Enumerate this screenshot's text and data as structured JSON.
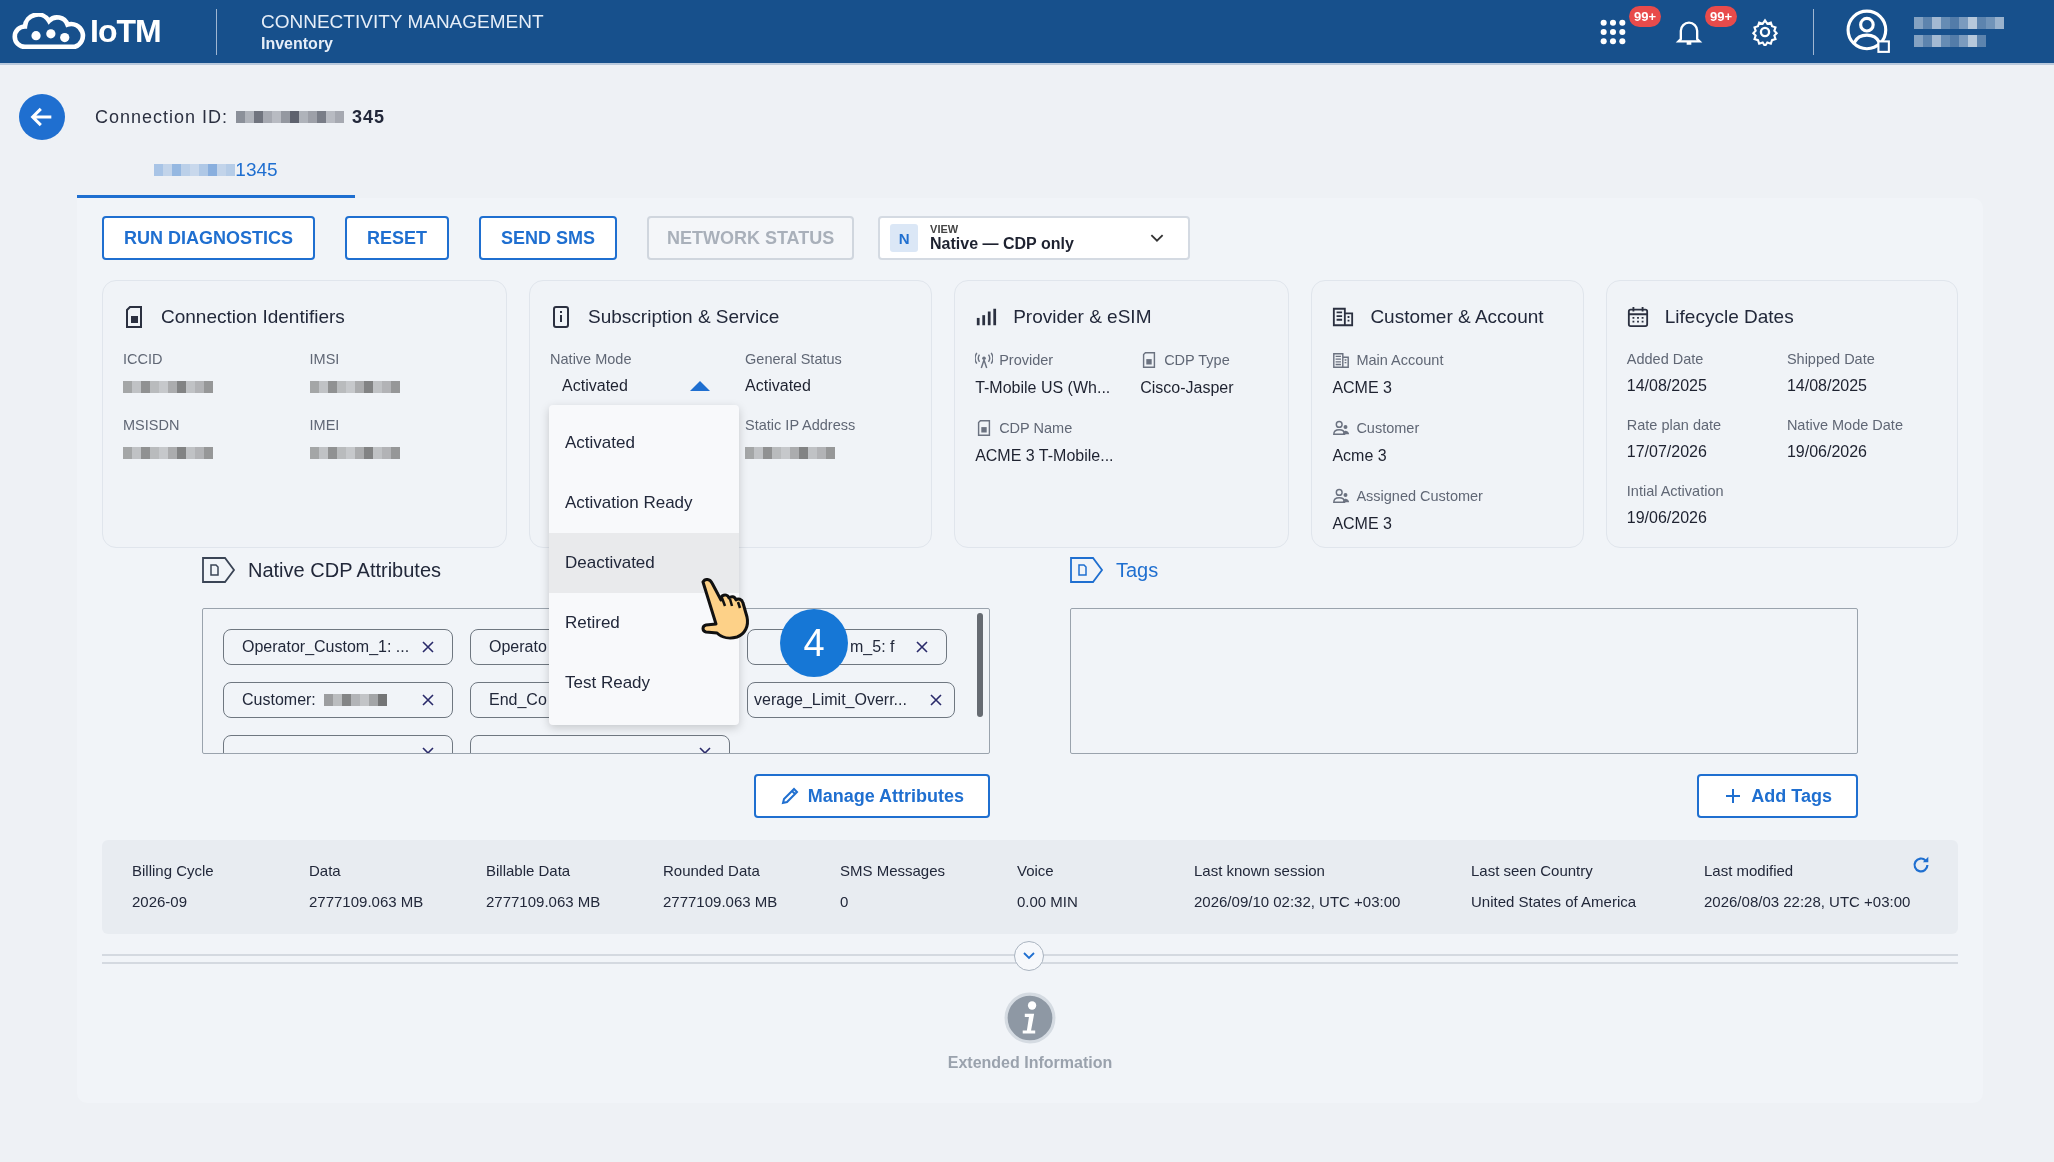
{
  "header": {
    "logo": "IoTM",
    "title": "CONNECTIVITY MANAGEMENT",
    "subtitle": "Inventory",
    "apps_badge": "99+",
    "notifications_badge": "99+"
  },
  "connection": {
    "label": "Connection ID:",
    "id_suffix": "345"
  },
  "tabs": [
    {
      "label": "1345",
      "selected": true
    }
  ],
  "actions": [
    {
      "label": "RUN DIAGNOSTICS",
      "disabled": false
    },
    {
      "label": "RESET",
      "disabled": false
    },
    {
      "label": "SEND SMS",
      "disabled": false
    },
    {
      "label": "NETWORK STATUS",
      "disabled": true
    }
  ],
  "view_select": {
    "badge": "N",
    "label": "VIEW",
    "value": "Native — CDP only"
  },
  "cards": [
    {
      "kind": "identifiers",
      "title": "Connection Identifiers",
      "fields": [
        {
          "kind": "plain",
          "label": "ICCID",
          "redacted": true
        },
        {
          "kind": "plain",
          "label": "IMSI",
          "redacted": true
        },
        {
          "kind": "plain",
          "label": "MSISDN",
          "redacted": true
        },
        {
          "kind": "plain",
          "label": "IMEI",
          "redacted": true
        }
      ]
    },
    {
      "kind": "subscription",
      "title": "Subscription & Service",
      "fields": [
        {
          "kind": "select",
          "label": "Native Mode",
          "value": "Activated",
          "expanded": true
        },
        {
          "kind": "plain",
          "label": "General Status",
          "value": "Activated"
        },
        {
          "kind": "plain",
          "label": "Static IP Address",
          "redacted": true
        }
      ]
    },
    {
      "kind": "provider",
      "title": "Provider & eSIM",
      "fields": [
        {
          "kind": "antenna",
          "label": "Provider",
          "value": "T-Mobile US (Wh..."
        },
        {
          "kind": "sim",
          "label": "CDP Type",
          "value": "Cisco-Jasper"
        },
        {
          "kind": "sim",
          "label": "CDP Name",
          "value": "ACME 3 T-Mobile..."
        }
      ]
    },
    {
      "kind": "customer",
      "title": "Customer & Account",
      "fields": [
        {
          "kind": "building",
          "label": "Main Account",
          "value": "ACME 3"
        },
        {
          "kind": "person",
          "label": "Customer",
          "value": "Acme 3"
        },
        {
          "kind": "person",
          "label": "Assigned Customer",
          "value": "ACME 3"
        }
      ]
    },
    {
      "kind": "lifecycle",
      "title": "Lifecycle Dates",
      "fields": [
        {
          "kind": "plain",
          "label": "Added Date",
          "value": "14/08/2025"
        },
        {
          "kind": "plain",
          "label": "Shipped Date",
          "value": "14/08/2025"
        },
        {
          "kind": "plain",
          "label": "Rate plan date",
          "value": "17/07/2026"
        },
        {
          "kind": "plain",
          "label": "Native Mode Date",
          "value": "19/06/2026"
        },
        {
          "kind": "plain",
          "label": "Intial Activation",
          "value": "19/06/2026"
        }
      ]
    }
  ],
  "native_mode_options": [
    {
      "label": "Activated",
      "hovered": false
    },
    {
      "label": "Activation Ready",
      "hovered": false
    },
    {
      "label": "Deactivated",
      "hovered": true
    },
    {
      "label": "Retired",
      "hovered": false
    },
    {
      "label": "Test Ready",
      "hovered": false
    }
  ],
  "step_badge": "4",
  "attributes": {
    "title": "Native CDP Attributes",
    "chips": [
      {
        "text": "Operator_Custom_1: ...",
        "redacted": false
      },
      {
        "text": "Operato",
        "redacted": false
      },
      {
        "text": "m_5: f",
        "redacted": false
      },
      {
        "text": "Customer:",
        "redacted": true
      },
      {
        "text": "End_Co",
        "redacted": false
      },
      {
        "text": "verage_Limit_Overr...",
        "redacted": false
      }
    ],
    "button": "Manage Attributes"
  },
  "tags": {
    "title": "Tags",
    "button": "Add Tags"
  },
  "usage": [
    {
      "label": "Billing Cycle",
      "value": "2026-09"
    },
    {
      "label": "Data",
      "value": "2777109.063 MB"
    },
    {
      "label": "Billable Data",
      "value": "2777109.063 MB"
    },
    {
      "label": "Rounded Data",
      "value": "2777109.063 MB"
    },
    {
      "label": "SMS Messages",
      "value": "0"
    },
    {
      "label": "Voice",
      "value": "0.00 MIN"
    },
    {
      "label": "Last known session",
      "value": "2026/09/10 02:32, UTC +03:00"
    },
    {
      "label": "Last seen Country",
      "value": "United States of America"
    },
    {
      "label": "Last modified",
      "value": "2026/08/03 22:28, UTC +03:00"
    }
  ],
  "extended": {
    "label": "Extended Information"
  }
}
